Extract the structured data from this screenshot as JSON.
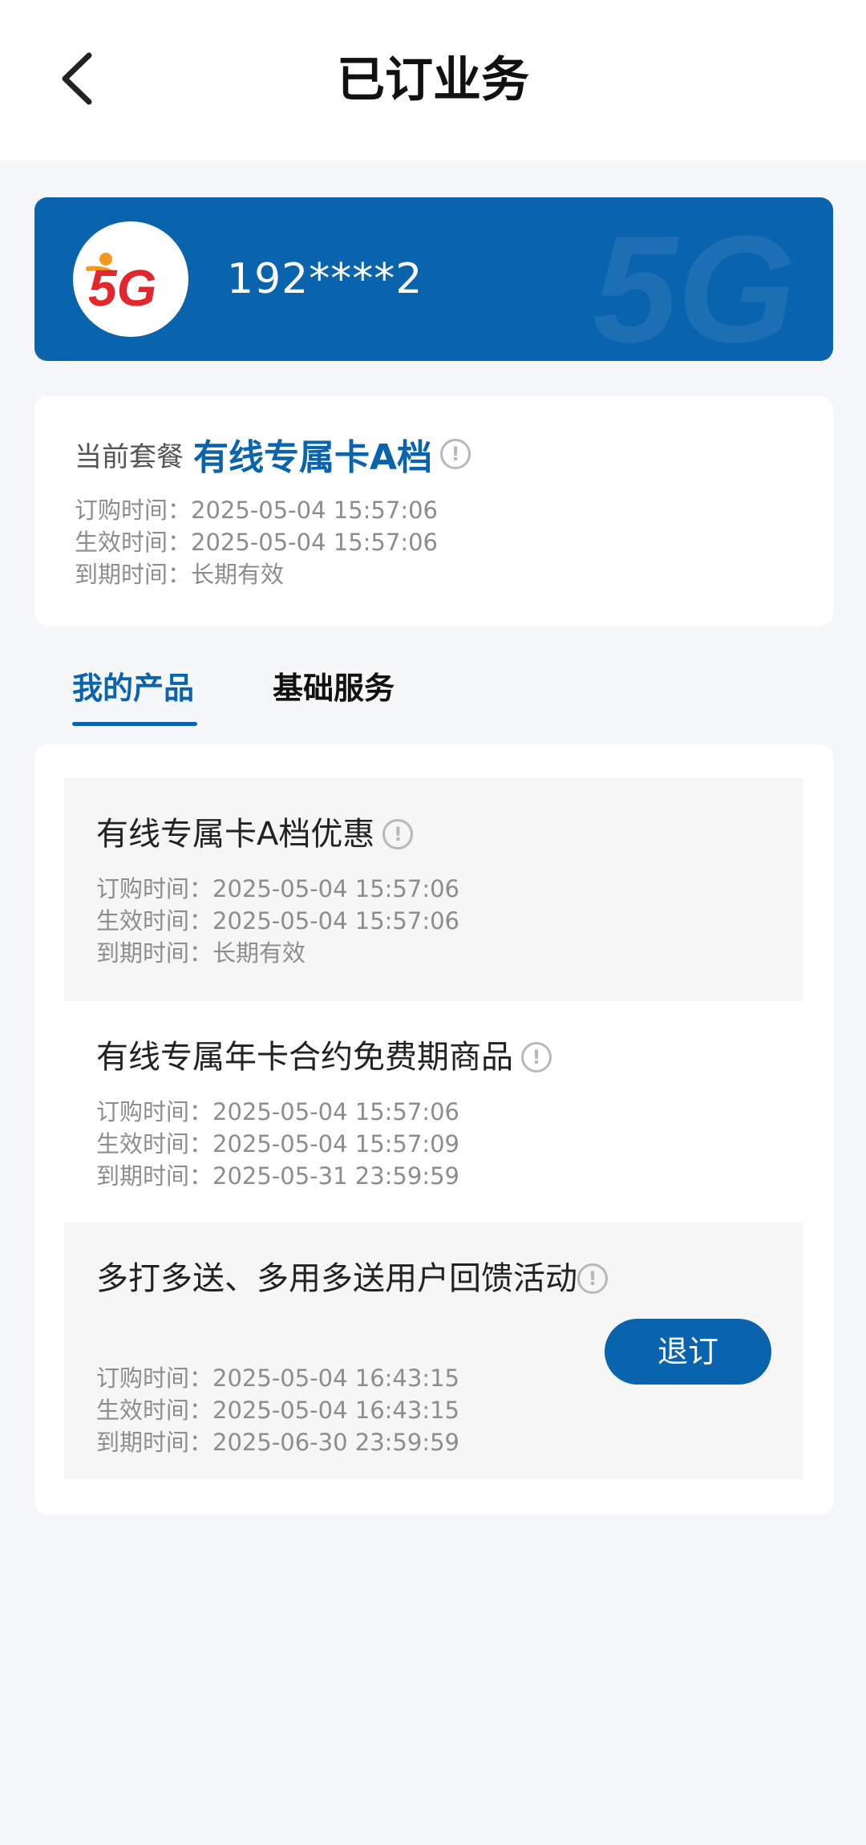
{
  "header": {
    "title": "已订业务",
    "back_icon": "chevron-left-icon"
  },
  "user": {
    "phone": "192****2",
    "avatar_logo_text": "5G",
    "watermark_text": "5G"
  },
  "current_plan": {
    "label": "当前套餐",
    "name": "有线专属卡A档",
    "order_time": "订购时间：2025-05-04 15:57:06",
    "effective_time": "生效时间：2025-05-04 15:57:06",
    "expire_time": "到期时间：长期有效"
  },
  "tabs": [
    {
      "label": "我的产品",
      "active": true
    },
    {
      "label": "基础服务",
      "active": false
    }
  ],
  "products": [
    {
      "title": "有线专属卡A档优惠",
      "order_time": "订购时间：2025-05-04 15:57:06",
      "effective_time": "生效时间：2025-05-04 15:57:06",
      "expire_time": "到期时间：长期有效"
    },
    {
      "title": "有线专属年卡合约免费期商品",
      "order_time": "订购时间：2025-05-04 15:57:06",
      "effective_time": "生效时间：2025-05-04 15:57:09",
      "expire_time": "到期时间：2025-05-31 23:59:59"
    },
    {
      "title": "多打多送、多用多送用户回馈活动",
      "order_time": "订购时间：2025-05-04 16:43:15",
      "effective_time": "生效时间：2025-05-04 16:43:15",
      "expire_time": "到期时间：2025-06-30 23:59:59",
      "action_label": "退订"
    }
  ],
  "info_icon_glyph": "!",
  "colors": {
    "brand_blue": "#0a63ad",
    "logo_red": "#e2262b",
    "logo_orange": "#f39a1e",
    "page_bg": "#f6f7f8"
  }
}
